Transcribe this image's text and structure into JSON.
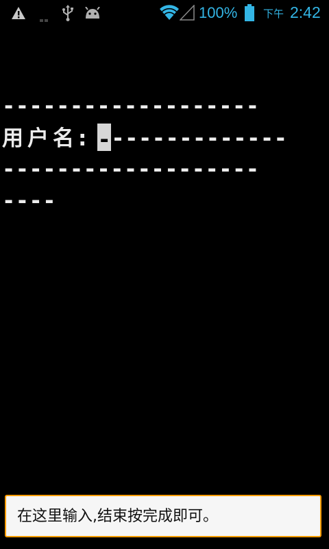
{
  "status_bar": {
    "icons": [
      "warning-icon",
      "more-notifications-icon",
      "usb-icon",
      "android-debug-icon",
      "wifi-icon",
      "signal-icon",
      "battery-icon"
    ],
    "battery_percent": "100%",
    "battery_level": 1.0,
    "time_period": "下午",
    "time": "2:42",
    "accent_color": "#33b5e5"
  },
  "terminal": {
    "line_1": "-------------------",
    "prompt_label": "用户名:",
    "cursor_char": "-",
    "line_2_rest": "-------------",
    "line_3": "-------------------",
    "line_4": "----",
    "text_color": "#ececec",
    "background": "#000000"
  },
  "input": {
    "placeholder": "在这里输入,结束按完成即可。",
    "value": "",
    "border_color": "#ff9c00"
  }
}
